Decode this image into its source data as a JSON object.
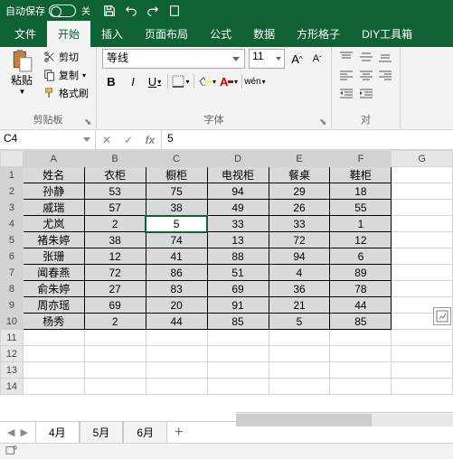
{
  "titlebar": {
    "autosave_label": "自动保存",
    "toggle_state": "关"
  },
  "ribbon": {
    "tabs": [
      "文件",
      "开始",
      "插入",
      "页面布局",
      "公式",
      "数据",
      "方形格子",
      "DIY工具箱"
    ],
    "active_tab_index": 1,
    "clipboard": {
      "paste": "粘贴",
      "cut": "剪切",
      "copy": "复制",
      "format_painter": "格式刷",
      "group_label": "剪贴板"
    },
    "font": {
      "name": "等线",
      "size": "11",
      "group_label": "字体",
      "wen": "wén"
    },
    "align": {
      "group_label": "对"
    }
  },
  "namebox": "C4",
  "formula_value": "5",
  "fxbtns": {
    "cancel": "✕",
    "confirm": "✓",
    "fx": "fx"
  },
  "columns": [
    "A",
    "B",
    "C",
    "D",
    "E",
    "F",
    "G"
  ],
  "rows": [
    "1",
    "2",
    "3",
    "4",
    "5",
    "6",
    "7",
    "8",
    "9",
    "10",
    "11",
    "12",
    "13",
    "14"
  ],
  "active_cell": {
    "row": 4,
    "col": 3
  },
  "data_range": {
    "row_start": 1,
    "row_end": 10,
    "col_start": 1,
    "col_end": 6
  },
  "table": {
    "headers": [
      "姓名",
      "衣柜",
      "橱柜",
      "电视柜",
      "餐桌",
      "鞋柜"
    ],
    "rows": [
      [
        "孙静",
        "53",
        "75",
        "94",
        "29",
        "18"
      ],
      [
        "戚瑞",
        "57",
        "38",
        "49",
        "26",
        "55"
      ],
      [
        "尤岚",
        "2",
        "5",
        "33",
        "33",
        "1"
      ],
      [
        "褚朱婷",
        "38",
        "74",
        "13",
        "72",
        "12"
      ],
      [
        "张珊",
        "12",
        "41",
        "88",
        "94",
        "6"
      ],
      [
        "闻春燕",
        "72",
        "86",
        "51",
        "4",
        "89"
      ],
      [
        "俞朱婷",
        "27",
        "83",
        "69",
        "36",
        "78"
      ],
      [
        "周亦瑶",
        "69",
        "20",
        "91",
        "21",
        "44"
      ],
      [
        "杨秀",
        "2",
        "44",
        "85",
        "5",
        "85"
      ]
    ]
  },
  "sheets": {
    "tabs": [
      "4月",
      "5月",
      "6月"
    ],
    "active_index": 0,
    "add": "+"
  }
}
